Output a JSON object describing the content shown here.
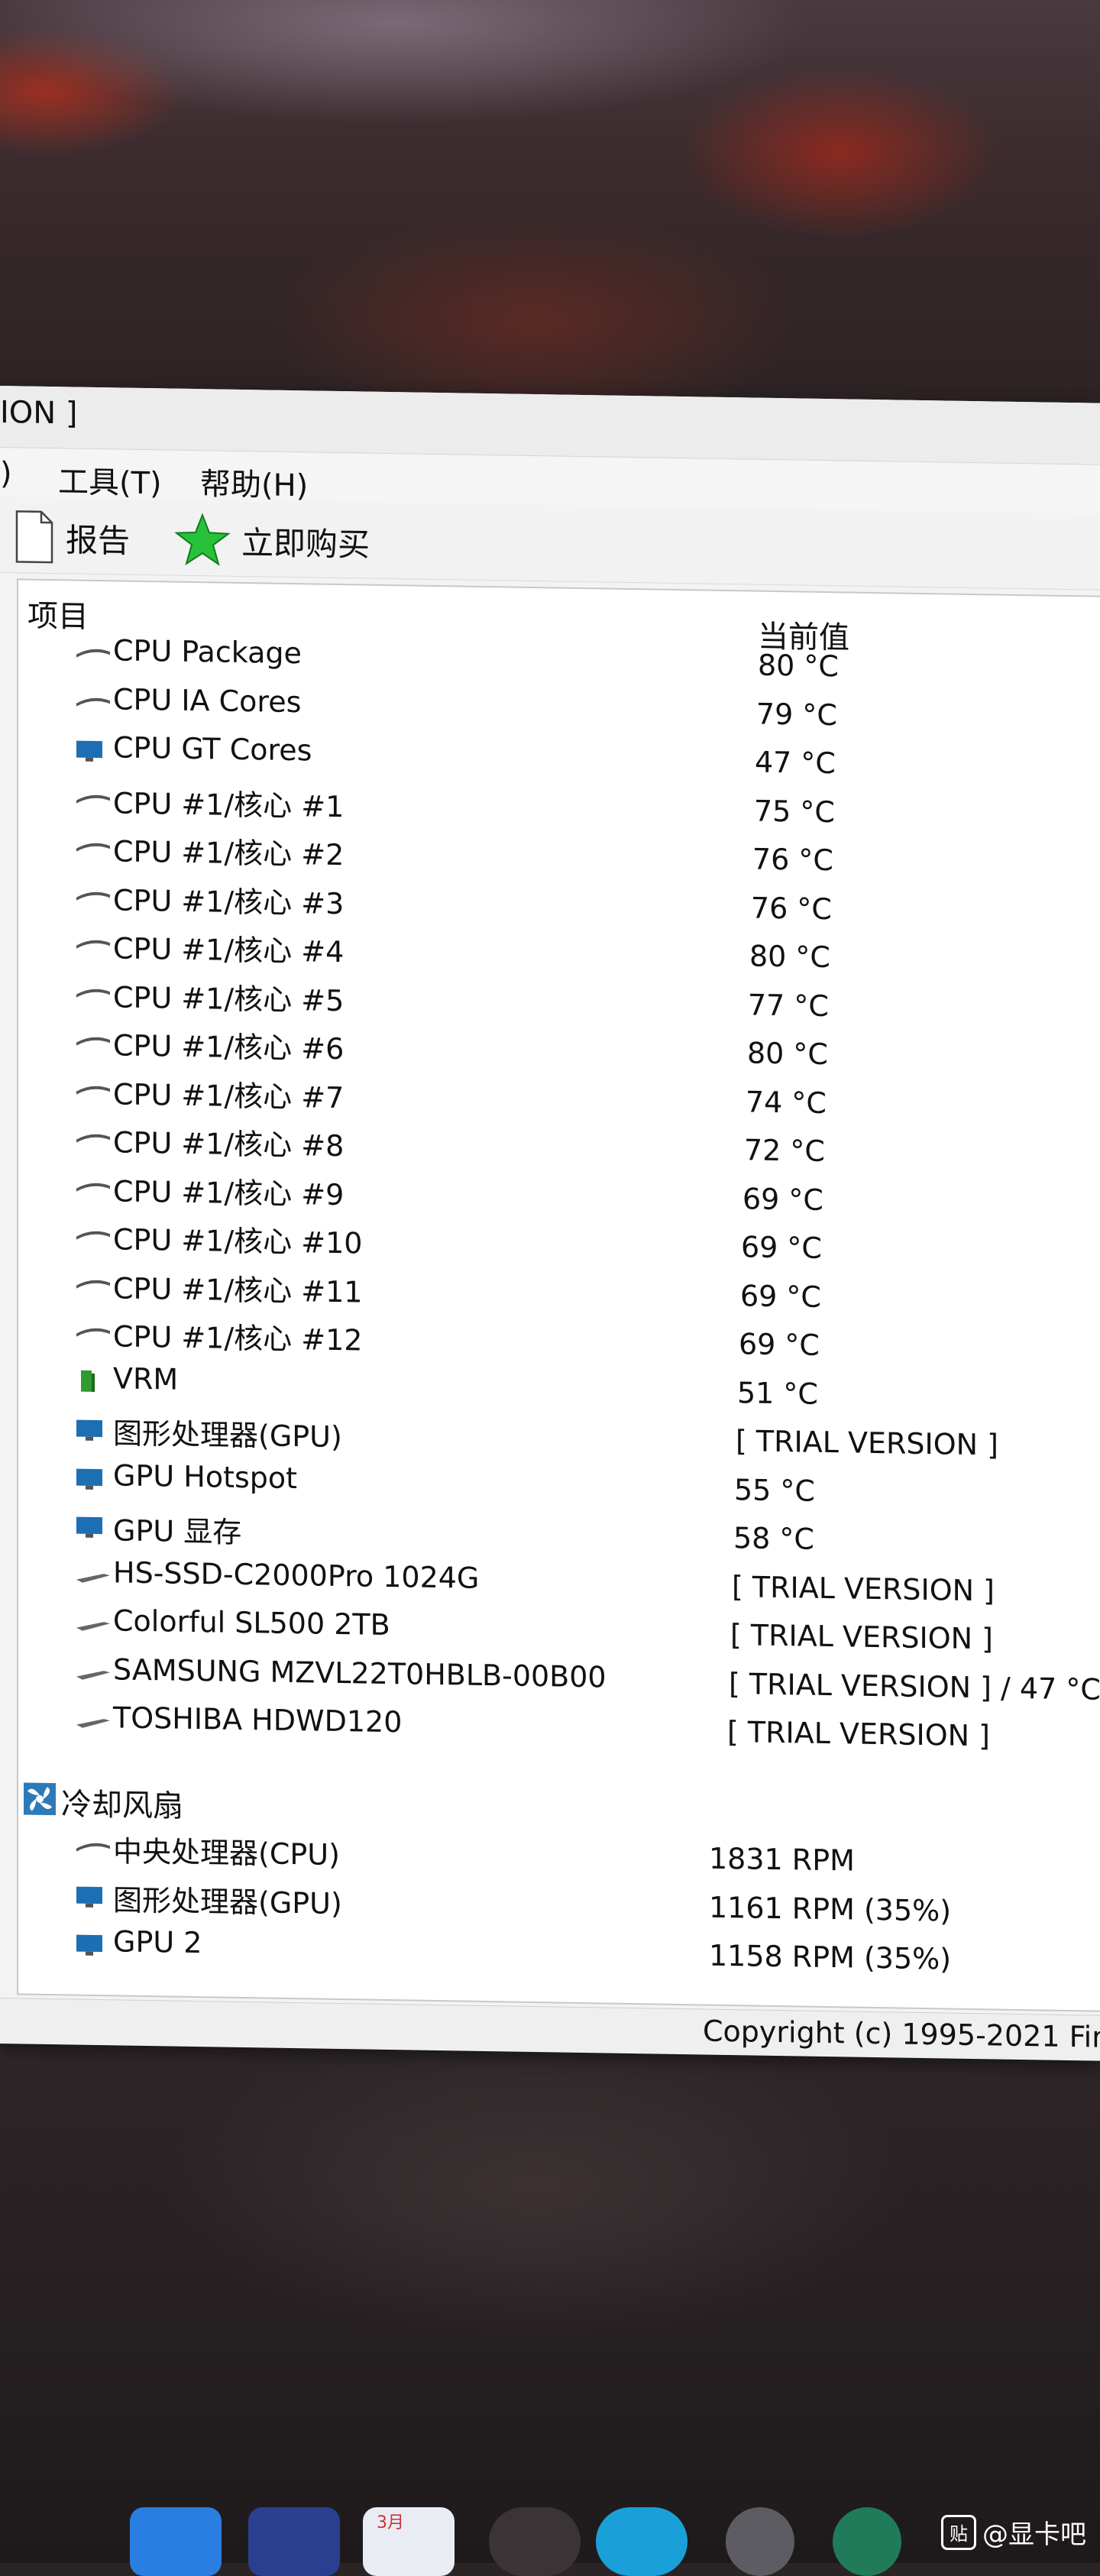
{
  "window": {
    "title_fragment": "ION ]"
  },
  "menu": {
    "items": [
      {
        "label": ")"
      },
      {
        "label": "工具(T)"
      },
      {
        "label": "帮助(H)"
      }
    ]
  },
  "toolbar": {
    "report_label": "报告",
    "buy_label": "立即购买"
  },
  "list": {
    "header_item": "项目",
    "header_value": "当前值",
    "temperature_rows": [
      {
        "label": "CPU Package",
        "value": "80 °C",
        "icon": "chip-icon"
      },
      {
        "label": "CPU IA Cores",
        "value": "79 °C",
        "icon": "chip-icon"
      },
      {
        "label": "CPU GT Cores",
        "value": "47 °C",
        "icon": "monitor-icon"
      },
      {
        "label": "CPU #1/核心 #1",
        "value": "75 °C",
        "icon": "chip-icon"
      },
      {
        "label": "CPU #1/核心 #2",
        "value": "76 °C",
        "icon": "chip-icon"
      },
      {
        "label": "CPU #1/核心 #3",
        "value": "76 °C",
        "icon": "chip-icon"
      },
      {
        "label": "CPU #1/核心 #4",
        "value": "80 °C",
        "icon": "chip-icon"
      },
      {
        "label": "CPU #1/核心 #5",
        "value": "77 °C",
        "icon": "chip-icon"
      },
      {
        "label": "CPU #1/核心 #6",
        "value": "80 °C",
        "icon": "chip-icon"
      },
      {
        "label": "CPU #1/核心 #7",
        "value": "74 °C",
        "icon": "chip-icon"
      },
      {
        "label": "CPU #1/核心 #8",
        "value": "72 °C",
        "icon": "chip-icon"
      },
      {
        "label": "CPU #1/核心 #9",
        "value": "69 °C",
        "icon": "chip-icon"
      },
      {
        "label": "CPU #1/核心 #10",
        "value": "69 °C",
        "icon": "chip-icon"
      },
      {
        "label": "CPU #1/核心 #11",
        "value": "69 °C",
        "icon": "chip-icon"
      },
      {
        "label": "CPU #1/核心 #12",
        "value": "69 °C",
        "icon": "chip-icon"
      },
      {
        "label": "VRM",
        "value": "51 °C",
        "icon": "vrm-icon"
      },
      {
        "label": "图形处理器(GPU)",
        "value": "[ TRIAL VERSION ]",
        "icon": "monitor-icon"
      },
      {
        "label": "GPU Hotspot",
        "value": "55 °C",
        "icon": "monitor-icon"
      },
      {
        "label": "GPU 显存",
        "value": "58 °C",
        "icon": "monitor-icon"
      },
      {
        "label": "HS-SSD-C2000Pro 1024G",
        "value": "[ TRIAL VERSION ]",
        "icon": "disk-icon"
      },
      {
        "label": "Colorful SL500 2TB",
        "value": "[ TRIAL VERSION ]",
        "icon": "disk-icon"
      },
      {
        "label": "SAMSUNG MZVL22T0HBLB-00B00",
        "value": "[ TRIAL VERSION ] / 47 °C",
        "icon": "disk-icon"
      },
      {
        "label": "TOSHIBA HDWD120",
        "value": "[ TRIAL VERSION ]",
        "icon": "disk-icon"
      }
    ],
    "fan_section": "冷却风扇",
    "fan_rows": [
      {
        "label": "中央处理器(CPU)",
        "value": "1831 RPM",
        "icon": "chip-icon"
      },
      {
        "label": "图形处理器(GPU)",
        "value": "1161 RPM  (35%)",
        "icon": "monitor-icon"
      },
      {
        "label": "GPU 2",
        "value": "1158 RPM  (35%)",
        "icon": "monitor-icon"
      }
    ]
  },
  "status": {
    "copyright": "Copyright (c) 1995-2021 Fina"
  },
  "taskbar": {
    "calendar_month": "3月"
  },
  "watermark": {
    "badge": "贴",
    "text": "@显卡吧"
  },
  "colors": {
    "chip": "#555555",
    "monitor": "#1c6fb3",
    "vrm": "#2e9b2e",
    "star": "#27c23a"
  }
}
